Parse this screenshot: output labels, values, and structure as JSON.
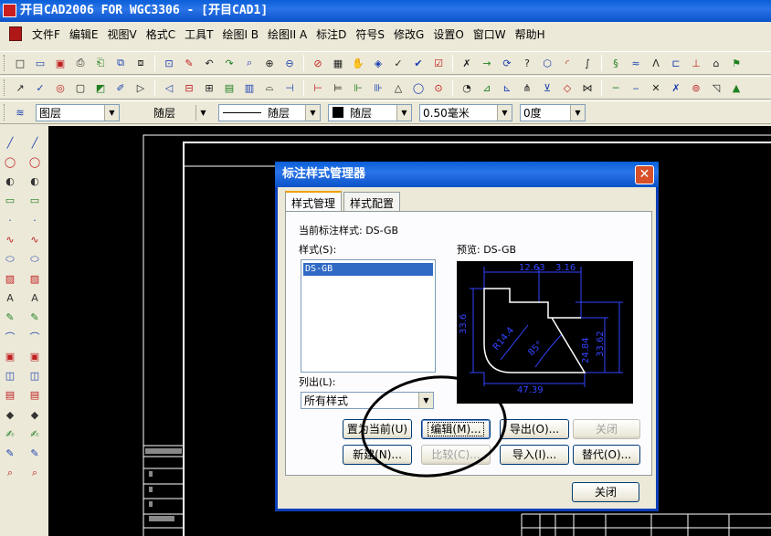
{
  "window": {
    "title": "开目CAD2006 FOR WGC3306 - [开目CAD1]"
  },
  "menu": [
    "文件F",
    "编辑E",
    "视图V",
    "格式C",
    "工具T",
    "绘图I B",
    "绘图II A",
    "标注D",
    "符号S",
    "修改G",
    "设置O",
    "窗口W",
    "帮助H"
  ],
  "props": {
    "layer": "图层",
    "linetype_layer": "随层",
    "linetype": "随层",
    "color": "随层",
    "lineweight": "0.50毫米",
    "angle": "0度"
  },
  "dialog": {
    "title": "标注样式管理器",
    "tabs": [
      "样式管理",
      "样式配置"
    ],
    "current_style_label": "当前标注样式: DS-GB",
    "styles_label": "样式(S):",
    "styles": [
      "DS-GB"
    ],
    "preview_label": "预览: DS-GB",
    "list_label": "列出(L):",
    "list_value": "所有样式",
    "buttons": {
      "set_current": "置为当前(U)",
      "edit": "编辑(M)...",
      "export": "导出(O)...",
      "close_top": "关闭",
      "new": "新建(N)...",
      "compare": "比较(C)...",
      "import": "导入(I)...",
      "replace": "替代(O)...",
      "close": "关闭"
    },
    "preview_dims": [
      "12.63",
      "3.16",
      "33.6",
      "R14.4",
      "85°",
      "24.84",
      "33.62",
      "47.39"
    ]
  },
  "colors": {
    "titlebar": "#0a5fd8",
    "selection": "#316ac5",
    "dim_blue": "#3344ff"
  },
  "icons": {
    "std_toolbar": [
      "new-icon",
      "open-icon",
      "save-icon",
      "print-preview-icon",
      "print-icon",
      "plot-icon",
      "copy-icon",
      "paste-icon",
      "brush-icon",
      "undo-icon",
      "redo-icon",
      "zoom-window-icon",
      "zoom-realtime-icon",
      "zoom-in-icon",
      "zoom-out-icon",
      "zoom-extents-icon",
      "pan-icon",
      "pan-previous-icon",
      "check1-icon",
      "check2-icon",
      "check3-icon",
      "check4-icon",
      "arrow-icon",
      "refresh-icon",
      "help-icon",
      "nut-icon",
      "arc-icon",
      "hook-icon",
      "spring-icon",
      "spring2-icon",
      "lambda-icon",
      "surface-icon",
      "vertical-icon",
      "cap-icon",
      "flag-icon"
    ],
    "draw_toolbar": [
      "snap1-icon",
      "snap2-icon",
      "snap3-icon",
      "snap4-icon",
      "snap5-icon",
      "snap6-icon",
      "snap7-icon",
      "snap8-icon",
      "snap9-icon",
      "snap10-icon",
      "snap11-icon",
      "snap12-icon",
      "snap13-icon",
      "dim1-icon",
      "dim2-icon",
      "dim3-icon",
      "dim4-icon",
      "dim5-icon",
      "dim6-icon",
      "circle1-icon",
      "circle2-icon",
      "circle3-icon",
      "dim7-icon",
      "dim8-icon",
      "dim9-icon",
      "dim10-icon",
      "dim11-icon",
      "dim12-icon",
      "line1-icon",
      "line2-icon",
      "cross-icon",
      "cross2-icon",
      "target-icon",
      "angle-icon",
      "triangle-icon"
    ],
    "left_col1": [
      "line-icon",
      "circle-icon",
      "arc-icon",
      "rect-icon",
      "point-icon",
      "spline-icon",
      "ellipse-icon",
      "hatch-icon",
      "text-icon",
      "pen-icon",
      "polyline-icon",
      "block-icon",
      "block2-icon",
      "folder-icon",
      "tag-icon",
      "edit-icon",
      "edit2-icon",
      "zoom-icon"
    ],
    "left_col2": [
      "erase-icon",
      "copy-icon",
      "mirror-icon",
      "offset-icon",
      "rotate-icon",
      "scale-icon",
      "stretch-icon",
      "trim-icon",
      "extend-icon",
      "fillet-icon",
      "chamfer-icon",
      "break-icon",
      "explode-icon",
      "array-icon",
      "move-icon",
      "layer-icon",
      "block3-icon",
      "tool-icon"
    ]
  }
}
